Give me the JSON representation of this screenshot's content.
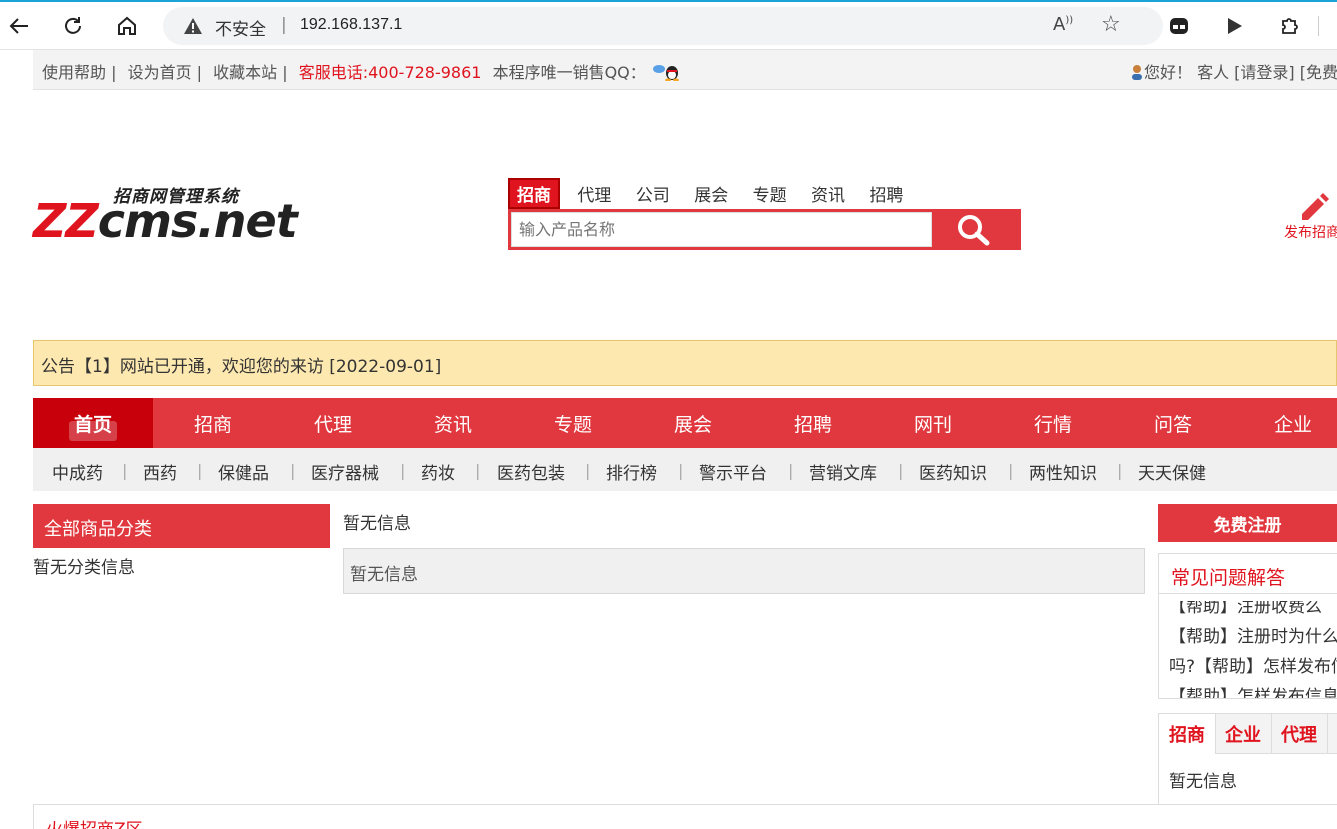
{
  "browser": {
    "insecure_label": "不安全",
    "separator": "|",
    "url": "192.168.137.1",
    "read_aloud": "Aͅ"
  },
  "topbar": {
    "help": "使用帮助 |",
    "set_home": "设为首页 |",
    "bookmark": "收藏本站 |",
    "hotline": "客服电话:400-728-9861",
    "qq_label": "本程序唯一销售QQ：",
    "greeting": "您好！ 客人 [请登录] [免费"
  },
  "logo": {
    "subtitle": "招商网管理系统",
    "brand_zz": "ZZ",
    "brand_rest": "cms.net"
  },
  "search": {
    "tabs": [
      "招商",
      "代理",
      "公司",
      "展会",
      "专题",
      "资讯",
      "招聘"
    ],
    "placeholder": "输入产品名称"
  },
  "publish": {
    "label": "发布招商"
  },
  "notice": {
    "text": "公告【1】网站已开通，欢迎您的来访 [2022-09-01]"
  },
  "main_nav": [
    "首页",
    "招商",
    "代理",
    "资讯",
    "专题",
    "展会",
    "招聘",
    "网刊",
    "行情",
    "问答",
    "企业"
  ],
  "sub_nav": [
    "中成药",
    "西药",
    "保健品",
    "医疗器械",
    "药妆",
    "医药包装",
    "排行榜",
    "警示平台",
    "营销文库",
    "医药知识",
    "两性知识",
    "天天保健"
  ],
  "sub_nav_sep": "|",
  "categories": {
    "title": "全部商品分类",
    "empty": "暂无分类信息"
  },
  "middle": {
    "title": "暂无信息",
    "box_text": "暂无信息"
  },
  "sidebar": {
    "register": "免费注册",
    "faq_title": "常见问题解答",
    "faq_items": [
      "【帮助】注册收费么",
      "【帮助】注册时为什么",
      "吗?【帮助】怎样发布信息",
      "【帮助】怎样发布信息"
    ],
    "tabs": [
      "招商",
      "企业",
      "代理"
    ],
    "tabs_empty": "暂无信息"
  },
  "hot_zone": {
    "title": "火爆招商Z区"
  },
  "colors": {
    "brand_red": "#e0383e",
    "dark_red": "#c8000b",
    "notice_bg": "#fde8b0"
  }
}
